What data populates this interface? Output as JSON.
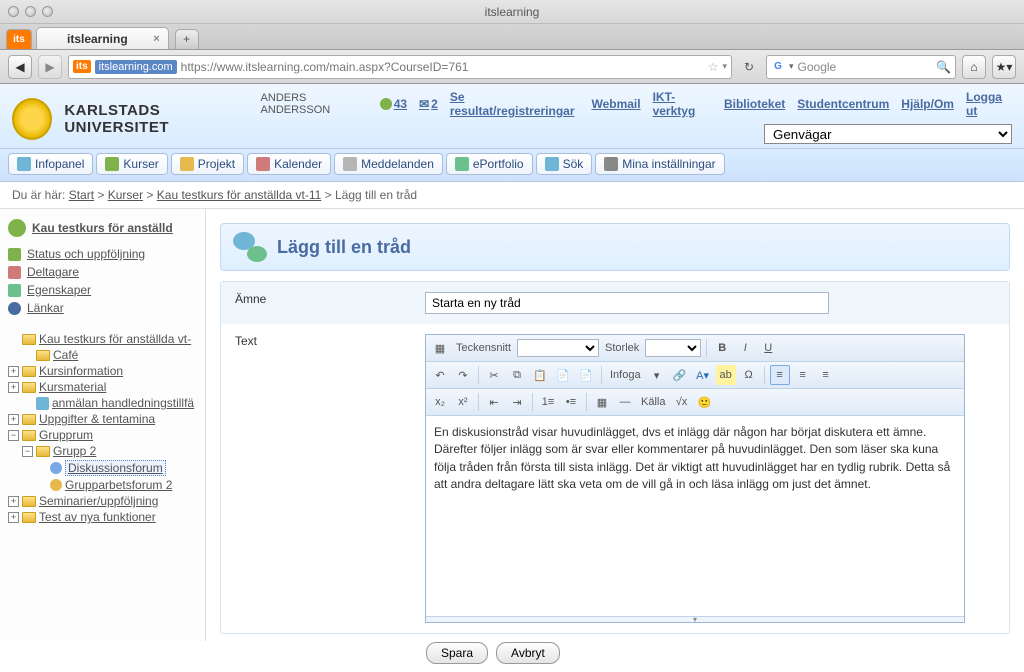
{
  "browser": {
    "window_title": "itslearning",
    "tab_title": "itslearning",
    "app_badge": "its",
    "url_domain": "itslearning.com",
    "url_rest": "https://www.itslearning.com/main.aspx?CourseID=761",
    "search_placeholder": "Google"
  },
  "header": {
    "university": "KARLSTADS UNIVERSITET",
    "user": "ANDERS ANDERSSON",
    "people_count": "43",
    "msg_count": "2",
    "links": [
      "Se resultat/registreringar",
      "Webmail",
      "IKT-verktyg",
      "Biblioteket",
      "Studentcentrum",
      "Hjälp/Om",
      "Logga ut"
    ],
    "shortcut_label": "Genvägar"
  },
  "mainnav": [
    {
      "label": "Infopanel",
      "color": "#6fb6d6"
    },
    {
      "label": "Kurser",
      "color": "#7fb24a"
    },
    {
      "label": "Projekt",
      "color": "#e7b94e"
    },
    {
      "label": "Kalender",
      "color": "#d07a7a"
    },
    {
      "label": "Meddelanden",
      "color": "#b5b5b5"
    },
    {
      "label": "ePortfolio",
      "color": "#6cc08c"
    },
    {
      "label": "Sök",
      "color": "#6fb6d6"
    },
    {
      "label": "Mina inställningar",
      "color": "#888"
    }
  ],
  "breadcrumb": {
    "prefix": "Du är här: ",
    "parts": [
      "Start",
      "Kurser",
      "Kau testkurs för anställda vt-11"
    ],
    "current": "Lägg till en tråd"
  },
  "sidebar": {
    "course_title": "Kau testkurs för anställd",
    "menu": [
      {
        "label": "Status och uppföljning",
        "color": "#7fb24a"
      },
      {
        "label": "Deltagare",
        "color": "#d07a7a"
      },
      {
        "label": "Egenskaper",
        "color": "#6cc08c"
      },
      {
        "label": "Länkar",
        "color": "#4a6ba0"
      }
    ],
    "tree": {
      "root": "Kau testkurs för anställda vt-",
      "cafe": "Café",
      "kursinfo": "Kursinformation",
      "kursmat": "Kursmaterial",
      "anmalan": "anmälan handledningstillfä",
      "uppgifter": "Uppgifter & tentamina",
      "grupprum": "Grupprum",
      "grupp2": "Grupp 2",
      "diskussion": "Diskussionsforum",
      "grupparbete": "Grupparbetsforum 2",
      "seminar": "Seminarier/uppföljning",
      "test": "Test av nya funktioner"
    }
  },
  "content": {
    "title": "Lägg till en tråd",
    "subject_label": "Ämne",
    "subject_value": "Starta en ny tråd",
    "text_label": "Text",
    "body_text": "En diskusionstråd visar huvudinlägget, dvs et inlägg där någon har börjat diskutera ett ämne. Därefter följer inlägg som är svar eller kommentarer på huvudinlägget. Den som läser ska kuna följa tråden från första till sista inlägg. Det är viktigt att huvudinlägget har en tydlig rubrik. Detta så att andra deltagare lätt ska veta om de vill gå in och läsa inlägg om just det ämnet.",
    "save": "Spara",
    "cancel": "Avbryt",
    "toolbar": {
      "font_label": "Teckensnitt",
      "size_label": "Storlek",
      "insert_label": "Infoga",
      "source_label": "Källa"
    }
  }
}
